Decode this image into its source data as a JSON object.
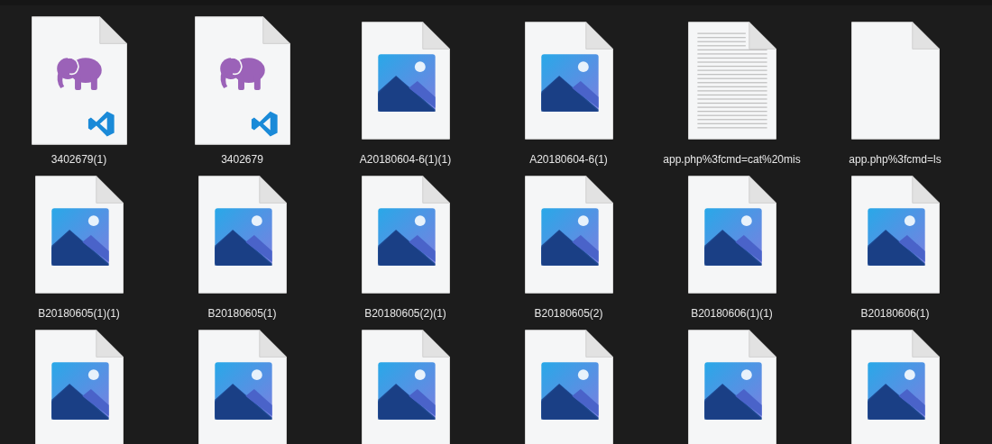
{
  "files": [
    {
      "kind": "vscode",
      "name": "3402679(1)"
    },
    {
      "kind": "vscode",
      "name": "3402679"
    },
    {
      "kind": "image",
      "name": "A20180604-6(1)(1)"
    },
    {
      "kind": "image",
      "name": "A20180604-6(1)"
    },
    {
      "kind": "text",
      "name": "app.php%3fcmd=cat%20mis"
    },
    {
      "kind": "blank",
      "name": "app.php%3fcmd=ls"
    },
    {
      "kind": "image",
      "name": "B20180605(1)(1)"
    },
    {
      "kind": "image",
      "name": "B20180605(1)"
    },
    {
      "kind": "image",
      "name": "B20180605(2)(1)"
    },
    {
      "kind": "image",
      "name": "B20180605(2)"
    },
    {
      "kind": "image",
      "name": "B20180606(1)(1)"
    },
    {
      "kind": "image",
      "name": "B20180606(1)"
    },
    {
      "kind": "image"
    },
    {
      "kind": "image"
    },
    {
      "kind": "image"
    },
    {
      "kind": "image"
    },
    {
      "kind": "image"
    },
    {
      "kind": "image"
    }
  ]
}
